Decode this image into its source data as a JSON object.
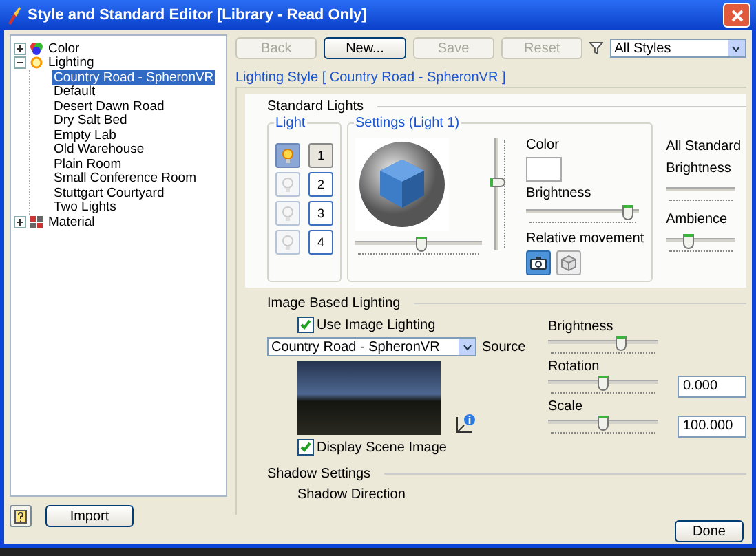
{
  "window": {
    "title": "Style and Standard Editor [Library - Read Only]"
  },
  "tree": [
    {
      "label": "Color",
      "kind": "color",
      "expanded": false,
      "selected": false
    },
    {
      "label": "Lighting",
      "kind": "lighting",
      "expanded": true,
      "selected": false,
      "children": [
        {
          "label": "Country Road - SpheronVR",
          "selected": true
        },
        {
          "label": "Default",
          "selected": false
        },
        {
          "label": "Desert Dawn Road",
          "selected": false
        },
        {
          "label": "Dry Salt Bed",
          "selected": false
        },
        {
          "label": "Empty Lab",
          "selected": false
        },
        {
          "label": "Old Warehouse",
          "selected": false
        },
        {
          "label": "Plain Room",
          "selected": false
        },
        {
          "label": "Small Conference Room",
          "selected": false
        },
        {
          "label": "Stuttgart Courtyard",
          "selected": false
        },
        {
          "label": "Two Lights",
          "selected": false
        }
      ]
    },
    {
      "label": "Material",
      "kind": "material",
      "expanded": false,
      "selected": false
    }
  ],
  "toolbar": [
    {
      "label": "Back",
      "disabled": true
    },
    {
      "label": "New...",
      "disabled": false
    },
    {
      "label": "Save",
      "disabled": true
    },
    {
      "label": "Reset",
      "disabled": true
    }
  ],
  "style_filter": {
    "value": "All Styles"
  },
  "panel_title": "Lighting Style [ Country Road - SpheronVR ]",
  "standard_lights": {
    "heading": "Standard Lights",
    "light_group": {
      "title": "Light",
      "lights": [
        {
          "label": "1",
          "on": true,
          "selected": true
        },
        {
          "label": "2",
          "on": false,
          "selected": false
        },
        {
          "label": "3",
          "on": false,
          "selected": false
        },
        {
          "label": "4",
          "on": false,
          "selected": false
        }
      ]
    },
    "settings": {
      "title": "Settings (Light 1)",
      "vertical": {
        "level": 0.62
      },
      "horizontal": {
        "level": 0.52
      },
      "color_label": "Color",
      "brightness_label": "Brightness",
      "brightness": {
        "level": 0.95
      },
      "relative_movement_label": "Relative movement",
      "movement_modes": [
        {
          "kind": "camera",
          "selected": true
        },
        {
          "kind": "scene",
          "selected": false
        }
      ]
    },
    "all_standard": {
      "label": "All Standard",
      "brightness_label": "Brightness",
      "ambience_label": "Ambience",
      "ambience": {
        "level": 0.3
      }
    }
  },
  "image_based": {
    "heading": "Image Based Lighting",
    "use_image_lighting": {
      "label": "Use Image Lighting",
      "checked": true
    },
    "source": {
      "value": "Country Road - SpheronVR",
      "label": "Source"
    },
    "display_scene_image": {
      "label": "Display Scene Image",
      "checked": true
    },
    "brightness": {
      "label": "Brightness",
      "level": 0.68
    },
    "rotation": {
      "label": "Rotation",
      "level": 0.5,
      "value": "0.000"
    },
    "scale": {
      "label": "Scale",
      "level": 0.5,
      "value": "100.000"
    }
  },
  "shadow": {
    "heading": "Shadow Settings",
    "direction_label": "Shadow Direction"
  },
  "footer": {
    "import": "Import",
    "done": "Done"
  }
}
